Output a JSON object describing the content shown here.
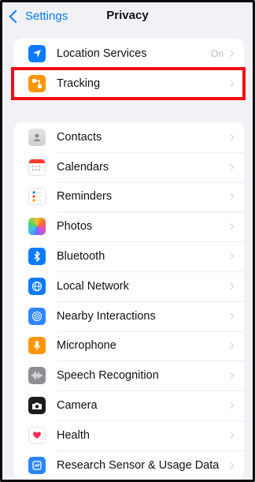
{
  "nav": {
    "back_label": "Settings",
    "title": "Privacy"
  },
  "group1": [
    {
      "label": "Location Services",
      "value": "On",
      "icon": "location-arrow-icon",
      "color": "#0a7aff"
    },
    {
      "label": "Tracking",
      "value": "",
      "icon": "tracking-icon",
      "color": "#ff9500"
    }
  ],
  "group2": [
    {
      "label": "Contacts",
      "icon": "contacts-icon"
    },
    {
      "label": "Calendars",
      "icon": "calendar-icon"
    },
    {
      "label": "Reminders",
      "icon": "reminders-icon"
    },
    {
      "label": "Photos",
      "icon": "photos-icon"
    },
    {
      "label": "Bluetooth",
      "icon": "bluetooth-icon"
    },
    {
      "label": "Local Network",
      "icon": "globe-icon"
    },
    {
      "label": "Nearby Interactions",
      "icon": "nearby-icon"
    },
    {
      "label": "Microphone",
      "icon": "microphone-icon"
    },
    {
      "label": "Speech Recognition",
      "icon": "waveform-icon"
    },
    {
      "label": "Camera",
      "icon": "camera-icon"
    },
    {
      "label": "Health",
      "icon": "heart-icon"
    },
    {
      "label": "Research Sensor & Usage Data",
      "icon": "research-icon"
    }
  ],
  "highlight_color": "#ee0f14"
}
